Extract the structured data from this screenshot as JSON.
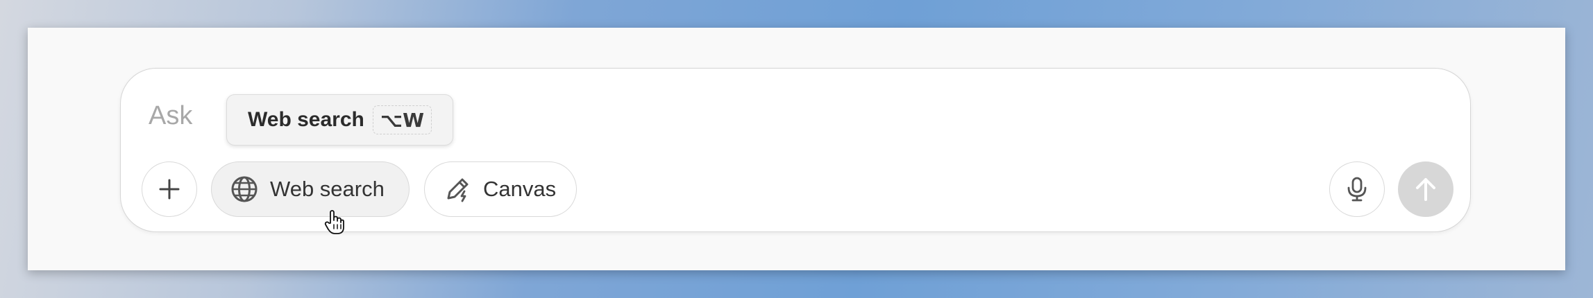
{
  "composer": {
    "placeholder": "Ask"
  },
  "tooltip": {
    "label": "Web search",
    "shortcut": "⌥W"
  },
  "toolbar": {
    "plus_icon": "plus-icon",
    "web_search_label": "Web search",
    "web_search_icon": "globe-icon",
    "canvas_label": "Canvas",
    "canvas_icon": "pencil-icon",
    "mic_icon": "microphone-icon",
    "send_icon": "arrow-up-icon"
  },
  "colors": {
    "send_button_bg": "#d7d7d7",
    "active_pill_bg": "#f1f1f1",
    "placeholder_text": "#a8a8a8"
  }
}
